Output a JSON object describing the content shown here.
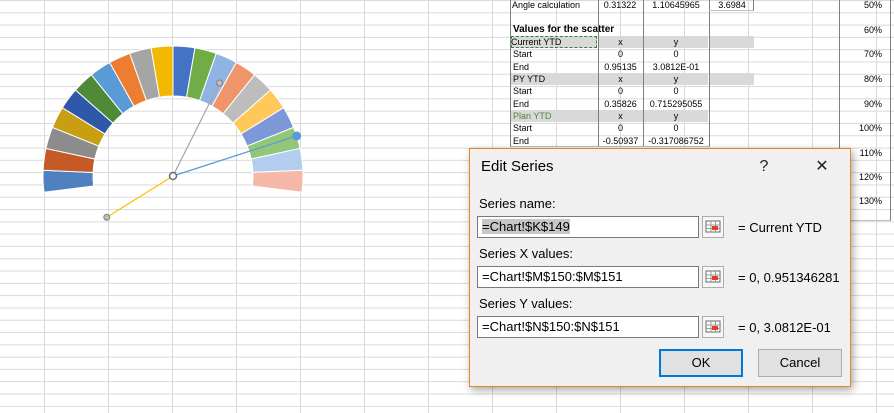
{
  "colors": {
    "dialog_border": "#e08a26",
    "ok_border": "#0078d7",
    "sheet_grid": "#d9d9d9",
    "header_fill": "#d9d9d9"
  },
  "sheet": {
    "angle_row": {
      "label": "Angle calculation",
      "v1": "0.31322",
      "v2": "1.10645965",
      "v3": "3.6984"
    },
    "section_title": "Values for the scatter",
    "blocks": [
      {
        "name": "Current YTD",
        "hx": "x",
        "hy": "y",
        "rows": [
          {
            "label": "Start",
            "x": "0",
            "y": "0"
          },
          {
            "label": "End",
            "x": "0.95135",
            "y": "3.0812E-01"
          }
        ]
      },
      {
        "name": "PY YTD",
        "hx": "x",
        "hy": "y",
        "rows": [
          {
            "label": "Start",
            "x": "0",
            "y": "0"
          },
          {
            "label": "End",
            "x": "0.35826",
            "y": "0.715295055"
          }
        ]
      },
      {
        "name": "Plan YTD",
        "hx": "x",
        "hy": "y",
        "rows": [
          {
            "label": "Start",
            "x": "0",
            "y": "0"
          },
          {
            "label": "End",
            "x": "-0.50937",
            "y": "-0.317086752"
          }
        ]
      }
    ],
    "percentages": [
      "50%",
      "60%",
      "70%",
      "80%",
      "90%",
      "100%",
      "110%",
      "120%",
      "130%"
    ]
  },
  "gauge": {
    "segment_colors": [
      "#4e81bd",
      "#c55a28",
      "#8c8c8c",
      "#c99e12",
      "#2f59a8",
      "#4f8a3a",
      "#5b9bd5",
      "#ed7d31",
      "#a5a5a5",
      "#f2b700",
      "#4472c4",
      "#70ad47",
      "#8fb4e3",
      "#f0956b",
      "#bdbdbd",
      "#ffc95a",
      "#7d98d6",
      "#92c77a",
      "#b3cdef",
      "#f6b8a6"
    ],
    "needles": [
      {
        "name": "Current YTD",
        "color": "#5b9bd5"
      },
      {
        "name": "PY YTD",
        "color": "#a5a5a5"
      },
      {
        "name": "Plan YTD",
        "color": "#ffc000"
      }
    ]
  },
  "dialog": {
    "title": "Edit Series",
    "help": "?",
    "close": "✕",
    "series_name_label": "Series name:",
    "series_name_value": "=Chart!$K$149",
    "series_name_result": "= Current YTD",
    "x_label": "Series X values:",
    "x_value": "=Chart!$M$150:$M$151",
    "x_result": "= 0, 0.951346281",
    "y_label": "Series Y values:",
    "y_value": "=Chart!$N$150:$N$151",
    "y_result": "= 0, 3.0812E-01",
    "ok": "OK",
    "cancel": "Cancel"
  }
}
